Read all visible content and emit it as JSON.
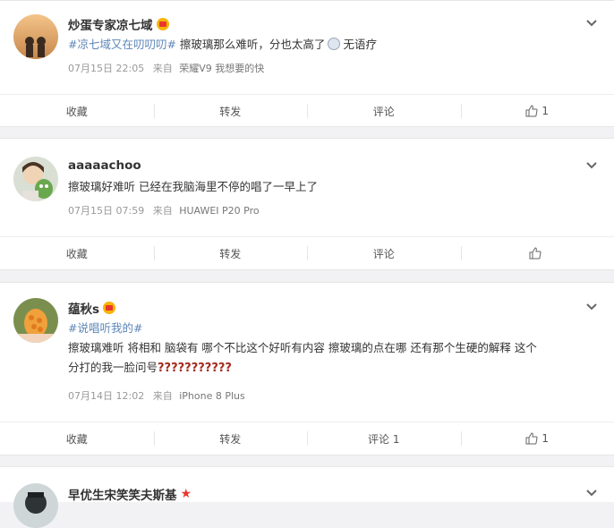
{
  "posts": [
    {
      "username": "炒蛋专家凉七域",
      "tag": "#凉七域又在叨叨叨#",
      "text": " 擦玻璃那么难听，分也太高了",
      "text_suffix": "无语疗",
      "date": "07月15日 22:05",
      "source_prefix": "来自",
      "device": "荣耀V9 我想要的快",
      "actions": {
        "collect": "收藏",
        "forward": "转发",
        "comment": "评论",
        "like": "1"
      }
    },
    {
      "username": "aaaaachoo",
      "text": "擦玻璃好难听 已经在我脑海里不停的唱了一早上了",
      "date": "07月15日 07:59",
      "source_prefix": "来自",
      "device": "HUAWEI P20 Pro",
      "actions": {
        "collect": "收藏",
        "forward": "转发",
        "comment": "评论",
        "like": ""
      }
    },
    {
      "username": "蕴秋s",
      "tag": "#说唱听我的#",
      "text_line1": "擦玻璃难听 将相和 脑袋有 哪个不比这个好听有内容 擦玻璃的点在哪 还有那个生硬的解释 这个",
      "text_line2": "分打的我一脸问号",
      "qmarks": "???????????",
      "date": "07月14日 12:02",
      "source_prefix": "来自",
      "device": "iPhone 8 Plus",
      "actions": {
        "collect": "收藏",
        "forward": "转发",
        "comment": "评论 1",
        "like": "1"
      }
    },
    {
      "username": "早优生宋笑笑夫斯基"
    }
  ],
  "colors": {
    "tag_orange": "#eb7350",
    "link_blue": "#5d86b7",
    "meta_gray": "#999999"
  }
}
